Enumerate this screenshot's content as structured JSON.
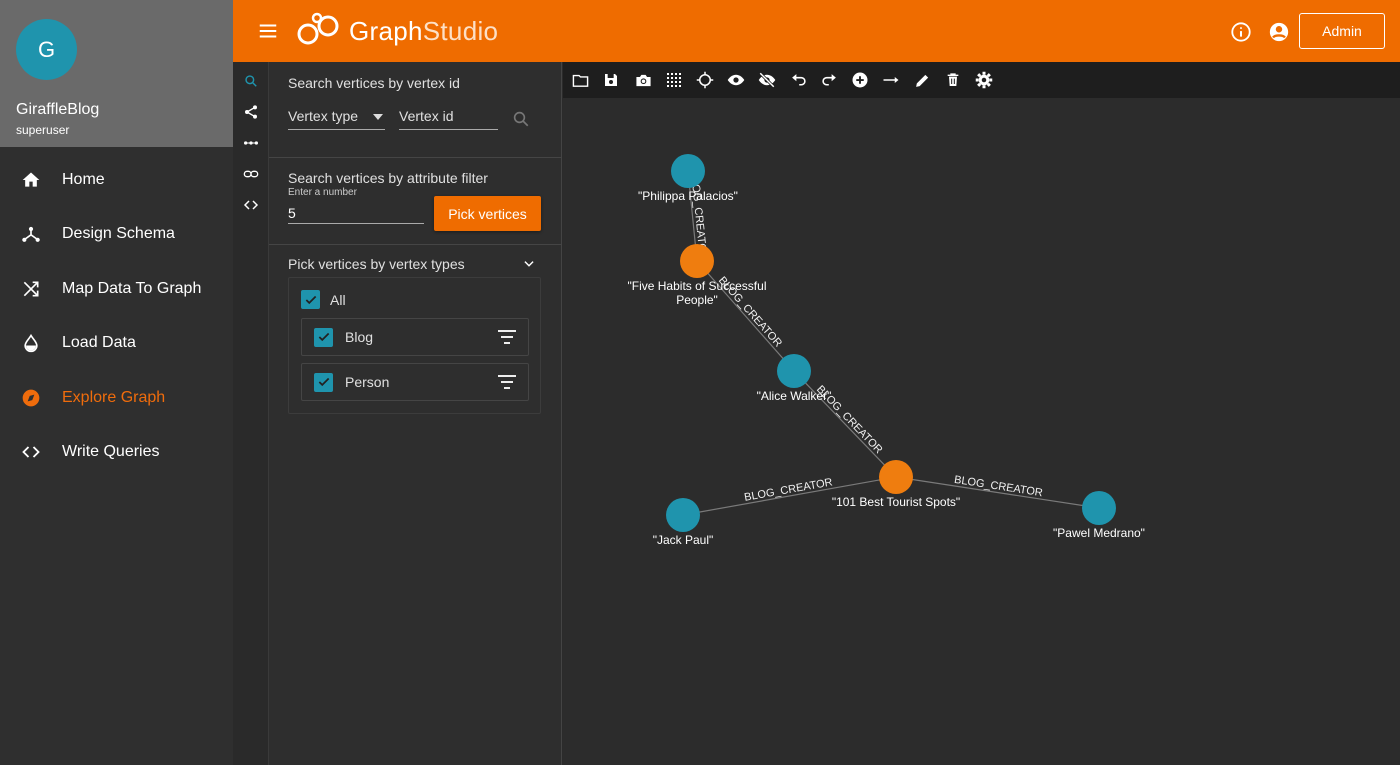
{
  "profile": {
    "avatar_letter": "G",
    "graph_name": "GiraffleBlog",
    "role": "superuser"
  },
  "nav": [
    {
      "label": "Home",
      "icon": "home-icon"
    },
    {
      "label": "Design Schema",
      "icon": "schema-icon"
    },
    {
      "label": "Map Data To Graph",
      "icon": "shuffle-icon"
    },
    {
      "label": "Load Data",
      "icon": "drop-icon"
    },
    {
      "label": "Explore Graph",
      "icon": "compass-icon",
      "active": true
    },
    {
      "label": "Write Queries",
      "icon": "code-icon"
    }
  ],
  "header": {
    "logo_main": "Graph",
    "logo_light": "Studio",
    "admin_label": "Admin"
  },
  "search": {
    "vertex_id_title": "Search vertices by vertex id",
    "vertex_type_placeholder": "Vertex type",
    "vertex_id_placeholder": "Vertex id",
    "attribute_title": "Search vertices by attribute filter",
    "number_hint": "Enter a number",
    "number_value": "5",
    "pick_button": "Pick vertices",
    "types_title": "Pick vertices by vertex types",
    "all_label": "All",
    "types": [
      {
        "label": "Blog"
      },
      {
        "label": "Person"
      }
    ]
  },
  "colors": {
    "accent": "#ef6c00",
    "person": "#1f94ad",
    "blog": "#ef7d0f"
  },
  "graph": {
    "nodes": [
      {
        "id": "philippa",
        "type": "Person",
        "label": "\"Philippa Palacios\""
      },
      {
        "id": "five",
        "type": "Blog",
        "label": "\"Five Habits of Successful",
        "label2": "People\""
      },
      {
        "id": "alice",
        "type": "Person",
        "label": "\"Alice Walker\""
      },
      {
        "id": "best",
        "type": "Blog",
        "label": "\"101 Best Tourist Spots\""
      },
      {
        "id": "jack",
        "type": "Person",
        "label": "\"Jack Paul\""
      },
      {
        "id": "pawel",
        "type": "Person",
        "label": "\"Pawel Medrano\""
      }
    ],
    "edges": [
      {
        "from": "philippa",
        "to": "five",
        "label": "BLOG_CREATOR"
      },
      {
        "from": "five",
        "to": "alice",
        "label": "BLOG_CREATOR"
      },
      {
        "from": "alice",
        "to": "best",
        "label": "BLOG_CREATOR"
      },
      {
        "from": "jack",
        "to": "best",
        "label": "BLOG_CREATOR"
      },
      {
        "from": "best",
        "to": "pawel",
        "label": "BLOG_CREATOR"
      }
    ]
  }
}
